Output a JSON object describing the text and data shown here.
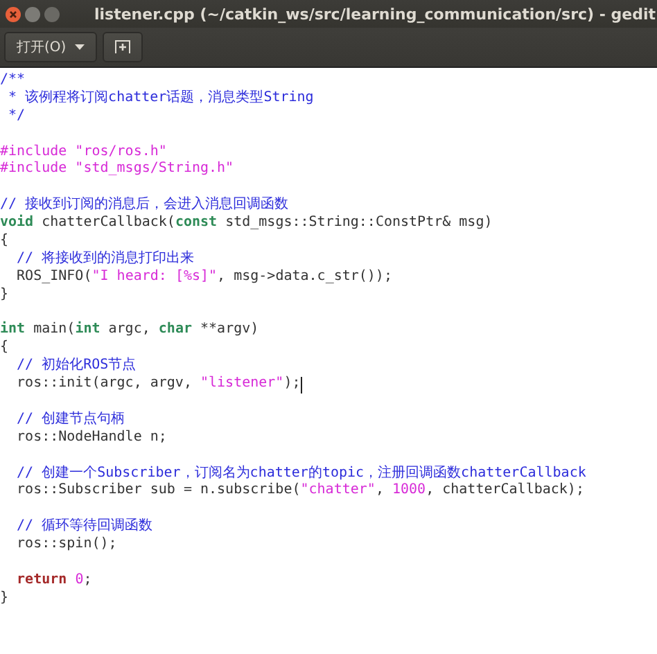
{
  "window": {
    "title": "listener.cpp (~/catkin_ws/src/learning_communication/src) - gedit"
  },
  "toolbar": {
    "open_button": {
      "label": "打开(O)"
    }
  },
  "editor": {
    "lines": [
      {
        "kind": "code",
        "tokens": [
          {
            "text": "/**",
            "kind": "comment"
          }
        ]
      },
      {
        "kind": "code",
        "tokens": [
          {
            "text": " * 该例程将订阅chatter话题，消息类型String",
            "kind": "comment"
          }
        ]
      },
      {
        "kind": "code",
        "tokens": [
          {
            "text": " */",
            "kind": "comment"
          }
        ]
      },
      {
        "kind": "blank"
      },
      {
        "kind": "code",
        "tokens": [
          {
            "text": "#include \"ros/ros.h\"",
            "kind": "preproc"
          }
        ]
      },
      {
        "kind": "code",
        "tokens": [
          {
            "text": "#include \"std_msgs/String.h\"",
            "kind": "preproc"
          }
        ]
      },
      {
        "kind": "blank"
      },
      {
        "kind": "code",
        "tokens": [
          {
            "text": "// 接收到订阅的消息后，会进入消息回调函数",
            "kind": "comment"
          }
        ]
      },
      {
        "kind": "code",
        "tokens": [
          {
            "text": "void",
            "kind": "type"
          },
          {
            "text": " chatterCallback(",
            "kind": "plain"
          },
          {
            "text": "const",
            "kind": "type"
          },
          {
            "text": " std_msgs::String::ConstPtr& msg)",
            "kind": "plain"
          }
        ]
      },
      {
        "kind": "code",
        "tokens": [
          {
            "text": "{",
            "kind": "plain"
          }
        ]
      },
      {
        "kind": "code",
        "tokens": [
          {
            "text": "  // 将接收到的消息打印出来",
            "kind": "comment"
          }
        ]
      },
      {
        "kind": "code",
        "tokens": [
          {
            "text": "  ROS_INFO(",
            "kind": "plain"
          },
          {
            "text": "\"I heard: [%s]\"",
            "kind": "string"
          },
          {
            "text": ", msg->data.c_str());",
            "kind": "plain"
          }
        ]
      },
      {
        "kind": "code",
        "tokens": [
          {
            "text": "}",
            "kind": "plain"
          }
        ]
      },
      {
        "kind": "blank"
      },
      {
        "kind": "code",
        "tokens": [
          {
            "text": "int",
            "kind": "type"
          },
          {
            "text": " main(",
            "kind": "plain"
          },
          {
            "text": "int",
            "kind": "type"
          },
          {
            "text": " argc, ",
            "kind": "plain"
          },
          {
            "text": "char",
            "kind": "type"
          },
          {
            "text": " **argv)",
            "kind": "plain"
          }
        ]
      },
      {
        "kind": "code",
        "tokens": [
          {
            "text": "{",
            "kind": "plain"
          }
        ]
      },
      {
        "kind": "code",
        "tokens": [
          {
            "text": "  // 初始化ROS节点",
            "kind": "comment"
          }
        ]
      },
      {
        "kind": "code",
        "tokens": [
          {
            "text": "  ros::init(argc, argv, ",
            "kind": "plain"
          },
          {
            "text": "\"listener\"",
            "kind": "string"
          },
          {
            "text": ");",
            "kind": "plain"
          },
          {
            "kind": "cursor"
          }
        ]
      },
      {
        "kind": "blank"
      },
      {
        "kind": "code",
        "tokens": [
          {
            "text": "  // 创建节点句柄",
            "kind": "comment"
          }
        ]
      },
      {
        "kind": "code",
        "tokens": [
          {
            "text": "  ros::NodeHandle n;",
            "kind": "plain"
          }
        ]
      },
      {
        "kind": "blank"
      },
      {
        "kind": "code",
        "tokens": [
          {
            "text": "  // 创建一个Subscriber，订阅名为chatter的topic，注册回调函数chatterCallback",
            "kind": "comment"
          }
        ]
      },
      {
        "kind": "code",
        "tokens": [
          {
            "text": "  ros::Subscriber sub = n.subscribe(",
            "kind": "plain"
          },
          {
            "text": "\"chatter\"",
            "kind": "string"
          },
          {
            "text": ", ",
            "kind": "plain"
          },
          {
            "text": "1000",
            "kind": "number"
          },
          {
            "text": ", chatterCallback);",
            "kind": "plain"
          }
        ]
      },
      {
        "kind": "blank"
      },
      {
        "kind": "code",
        "tokens": [
          {
            "text": "  // 循环等待回调函数",
            "kind": "comment"
          }
        ]
      },
      {
        "kind": "code",
        "tokens": [
          {
            "text": "  ros::spin();",
            "kind": "plain"
          }
        ]
      },
      {
        "kind": "blank"
      },
      {
        "kind": "code",
        "tokens": [
          {
            "text": "  return",
            "kind": "keyword"
          },
          {
            "text": " 0",
            "kind": "number"
          },
          {
            "text": ";",
            "kind": "plain"
          }
        ]
      },
      {
        "kind": "code",
        "tokens": [
          {
            "text": "}",
            "kind": "plain"
          }
        ]
      }
    ]
  }
}
